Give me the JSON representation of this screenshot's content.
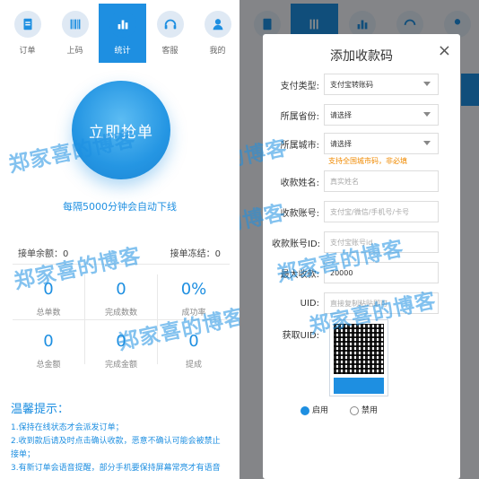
{
  "tabs": [
    {
      "label": "订单",
      "icon": "document-icon"
    },
    {
      "label": "上码",
      "icon": "barcode-icon"
    },
    {
      "label": "统计",
      "icon": "bar-chart-icon"
    },
    {
      "label": "客服",
      "icon": "headset-icon"
    },
    {
      "label": "我的",
      "icon": "user-icon"
    }
  ],
  "active_tab": 2,
  "main": {
    "grab_button": "立即抢单",
    "auto_offline": "每隔5000分钟会自动下线",
    "balance_label": "接单余额：",
    "balance_value": "0",
    "frozen_label": "接单冻结：",
    "frozen_value": "0",
    "stats": [
      {
        "value": "0",
        "caption": "总单数"
      },
      {
        "value": "0",
        "caption": "完成数数"
      },
      {
        "value": "0%",
        "caption": "成功率"
      },
      {
        "value": "0",
        "caption": "总金额"
      },
      {
        "value": "0",
        "caption": "完成金额"
      },
      {
        "value": "0",
        "caption": "提成"
      }
    ]
  },
  "tips": {
    "title": "温馨提示：",
    "lines": [
      "1.保持在线状态才会派发订单；",
      "2.收到款后请及时点击确认收款，恶意不确认可能会被禁止",
      "接单；",
      "3.有新订单会语音提醒，部分手机要保持屏幕常亮才有语音"
    ]
  },
  "modal": {
    "title": "添加收款码",
    "close": "×",
    "fields": [
      {
        "label": "支付类型:",
        "value": "支付宝转账码",
        "type": "select"
      },
      {
        "label": "所属省份:",
        "value": "请选择",
        "type": "select"
      },
      {
        "label": "所属城市:",
        "value": "请选择",
        "type": "select"
      },
      {
        "label": "收款姓名:",
        "placeholder": "真实姓名",
        "type": "input"
      },
      {
        "label": "收款账号:",
        "placeholder": "支付宝/微信/手机号/卡号",
        "type": "input"
      },
      {
        "label": "收款账号ID:",
        "placeholder": "支付宝账号id",
        "type": "input"
      },
      {
        "label": "最大收款:",
        "value": "20000",
        "type": "input"
      },
      {
        "label": "UID:",
        "placeholder": "直接复制粘贴即可",
        "type": "input"
      }
    ],
    "hint": "支持全国城市码，非必填",
    "qr_label": "获取UID:",
    "radio": [
      "启用",
      "禁用"
    ]
  },
  "watermark": "郑家喜的博客",
  "colors": {
    "accent": "#1e8fe1",
    "hint": "#f08a00"
  }
}
